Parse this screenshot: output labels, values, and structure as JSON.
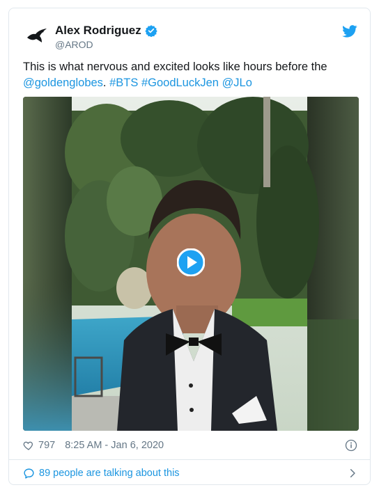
{
  "tweet": {
    "display_name": "Alex Rodriguez",
    "handle": "@AROD",
    "verified": true,
    "text_plain": "This is what nervous and excited looks like hours before the ",
    "text_link_1": "@goldenglobes",
    "text_link_2": "#BTS",
    "text_link_3": "#GoodLuckJen",
    "text_link_4": "@JLo",
    "likes": "797",
    "timestamp": "8:25 AM - Jan 6, 2020",
    "talking": "89 people are talking about this"
  },
  "icons": {
    "logo": "bird-icon",
    "verified": "verified-badge-icon",
    "like": "heart-icon",
    "info": "info-icon",
    "reply": "speech-bubble-icon",
    "chevron": "chevron-right-icon",
    "play": "play-icon"
  },
  "colors": {
    "link": "#1b95e0",
    "text": "#14171a",
    "muted": "#657786",
    "border": "#e1e8ed"
  }
}
